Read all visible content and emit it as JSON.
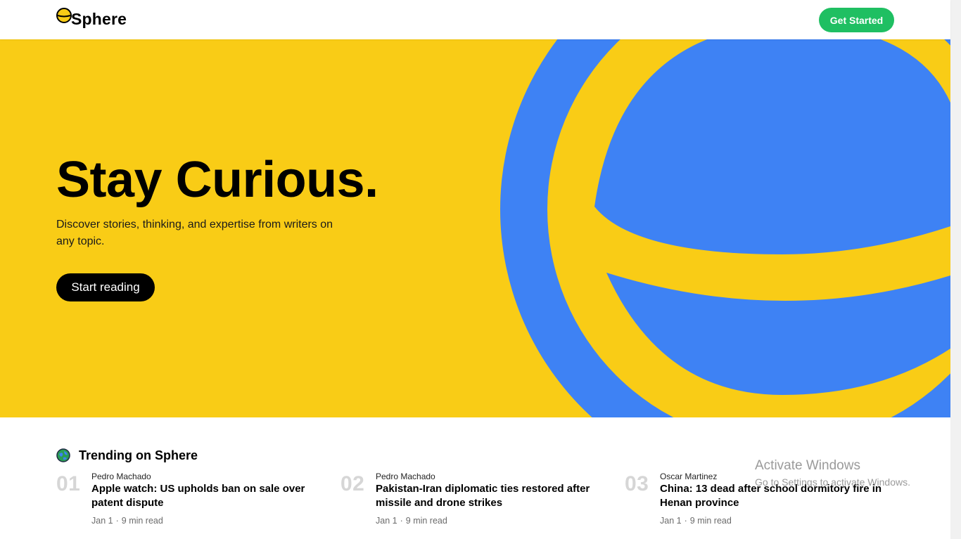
{
  "header": {
    "brand": "Sphere",
    "cta_label": "Get Started"
  },
  "hero": {
    "title": "Stay Curious.",
    "subtitle": "Discover stories, thinking, and expertise from writers on any topic.",
    "button_label": "Start reading"
  },
  "trending": {
    "heading": "Trending on Sphere",
    "items": [
      {
        "num": "01",
        "author": "Pedro Machado",
        "title": "Apple watch: US upholds ban on sale over patent dispute",
        "date": "Jan 1",
        "read_time": "9 min read"
      },
      {
        "num": "02",
        "author": "Pedro Machado",
        "title": "Pakistan-Iran diplomatic ties restored after missile and drone strikes",
        "date": "Jan 1",
        "read_time": "9 min read"
      },
      {
        "num": "03",
        "author": "Oscar Martinez",
        "title": "China: 13 dead after school dormitory fire in Henan province",
        "date": "Jan 1",
        "read_time": "9 min read"
      }
    ]
  },
  "watermark": {
    "line1": "Activate Windows",
    "line2": "Go to Settings to activate Windows."
  },
  "colors": {
    "hero_yellow": "#f9cc16",
    "sphere_blue": "#3e82f4",
    "cta_green": "#1fbf62",
    "number_gray": "#d6d6d6"
  },
  "icons": {
    "logo": "sphere-logo-icon",
    "trending": "globe-icon"
  }
}
